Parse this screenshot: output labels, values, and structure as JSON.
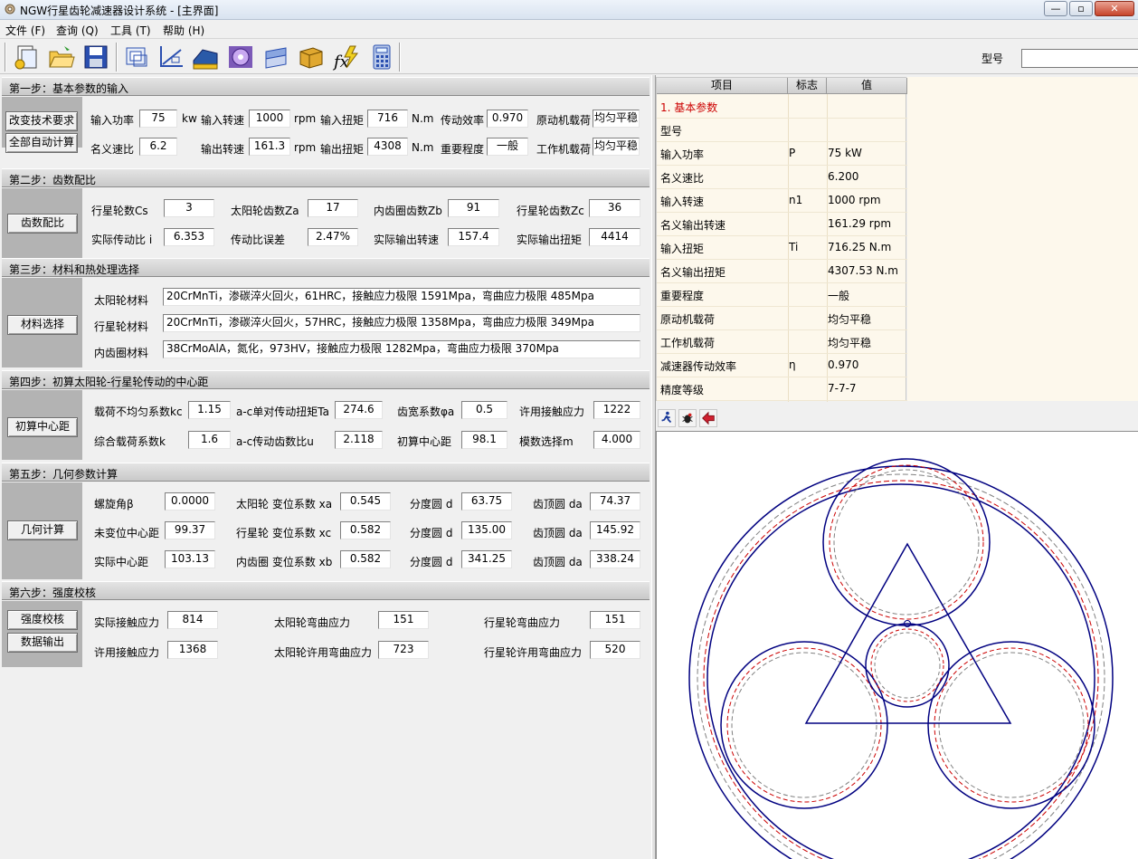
{
  "window": {
    "title": "NGW行星齿轮减速器设计系统 - [主界面]",
    "minimize": "—",
    "restore": "▫",
    "close": "✕"
  },
  "menu": [
    "文件 (F)",
    "查询 (Q)",
    "工具 (T)",
    "帮助 (H)"
  ],
  "toolbar": {
    "icons": [
      "new-doc-icon",
      "open-folder-icon",
      "save-disk-icon",
      "print-preview-icon",
      "axes-chart-icon",
      "ruler-block-icon",
      "gear-disc-icon",
      "layers-icon",
      "box-icon",
      "fx-formula-icon",
      "calculator-icon"
    ],
    "model_label": "型号",
    "model_value": ""
  },
  "step1": {
    "header": "第一步：基本参数的输入",
    "buttons": [
      "改变技术要求",
      "全部自动计算"
    ],
    "input_power_label": "输入功率",
    "input_power": "75",
    "input_power_unit": "kw",
    "input_speed_label": "输入转速",
    "input_speed": "1000",
    "input_speed_unit": "rpm",
    "input_torque_label": "输入扭矩",
    "input_torque": "716",
    "input_torque_unit": "N.m",
    "efficiency_label": "传动效率",
    "efficiency": "0.970",
    "prime_mover_label": "原动机载荷",
    "prime_mover": "均匀平稳",
    "ratio_label": "名义速比",
    "ratio": "6.2",
    "output_speed_label": "输出转速",
    "output_speed": "161.3",
    "output_speed_unit": "rpm",
    "output_torque_label": "输出扭矩",
    "output_torque": "4308",
    "output_torque_unit": "N.m",
    "importance_label": "重要程度",
    "importance": "一般",
    "work_machine_label": "工作机载荷",
    "work_machine": "均匀平稳"
  },
  "step2": {
    "header": "第二步：齿数配比",
    "button": "齿数配比",
    "cs_label": "行星轮数Cs",
    "cs": "3",
    "za_label": "太阳轮齿数Za",
    "za": "17",
    "zb_label": "内齿圈齿数Zb",
    "zb": "91",
    "zc_label": "行星轮齿数Zc",
    "zc": "36",
    "actual_ratio_label": "实际传动比 i",
    "actual_ratio": "6.353",
    "ratio_error_label": "传动比误差",
    "ratio_error": "2.47%",
    "actual_out_speed_label": "实际输出转速",
    "actual_out_speed": "157.4",
    "actual_out_torque_label": "实际输出扭矩",
    "actual_out_torque": "4414"
  },
  "step3": {
    "header": "第三步：材料和热处理选择",
    "button": "材料选择",
    "sun_label": "太阳轮材料",
    "sun": "20CrMnTi，渗碳淬火回火，61HRC，接触应力极限 1591Mpa，弯曲应力极限 485Mpa",
    "planet_label": "行星轮材料",
    "planet": "20CrMnTi，渗碳淬火回火，57HRC，接触应力极限 1358Mpa，弯曲应力极限 349Mpa",
    "ring_label": "内齿圈材料",
    "ring": "38CrMoAlA，氮化，973HV，接触应力极限 1282Mpa，弯曲应力极限 370Mpa"
  },
  "step4": {
    "header": "第四步：初算太阳轮-行星轮传动的中心距",
    "button": "初算中心距",
    "kc_label": "载荷不均匀系数kc",
    "kc": "1.15",
    "ta_label": "a-c单对传动扭矩Ta",
    "ta": "274.6",
    "phia_label": "齿宽系数φa",
    "phia": "0.5",
    "allow_contact_label": "许用接触应力",
    "allow_contact": "1222",
    "k_label": "综合载荷系数k",
    "k": "1.6",
    "u_label": "a-c传动齿数比u",
    "u": "2.118",
    "init_center_label": "初算中心距",
    "init_center": "98.1",
    "module_label": "模数选择m",
    "module": "4.000"
  },
  "step5": {
    "header": "第五步：几何参数计算",
    "button": "几何计算",
    "beta_label": "螺旋角β",
    "beta": "0.0000",
    "xa_label": "太阳轮 变位系数 xa",
    "xa": "0.545",
    "d1_label": "分度圆 d",
    "d1": "63.75",
    "da1_label": "齿顶圆 da",
    "da1": "74.37",
    "unshift_center_label": "未变位中心距",
    "unshift_center": "99.37",
    "xc_label": "行星轮 变位系数 xc",
    "xc": "0.582",
    "d2_label": "分度圆 d",
    "d2": "135.00",
    "da2_label": "齿顶圆 da",
    "da2": "145.92",
    "actual_center_label": "实际中心距",
    "actual_center": "103.13",
    "xb_label": "内齿圈 变位系数 xb",
    "xb": "0.582",
    "d3_label": "分度圆 d",
    "d3": "341.25",
    "da3_label": "齿顶圆 da",
    "da3": "338.24"
  },
  "step6": {
    "header": "第六步：强度校核",
    "buttons": [
      "强度校核",
      "数据输出"
    ],
    "actual_contact_label": "实际接触应力",
    "actual_contact": "814",
    "sun_bend_label": "太阳轮弯曲应力",
    "sun_bend": "151",
    "planet_bend_label": "行星轮弯曲应力",
    "planet_bend": "151",
    "allow_contact_label": "许用接触应力",
    "allow_contact": "1368",
    "sun_allow_bend_label": "太阳轮许用弯曲应力",
    "sun_allow_bend": "723",
    "planet_allow_bend_label": "行星轮许用弯曲应力",
    "planet_allow_bend": "520"
  },
  "info_table": {
    "columns": [
      "项目",
      "标志",
      "值"
    ],
    "rows": [
      {
        "item": "1. 基本参数",
        "symbol": "",
        "value": ""
      },
      {
        "item": "型号",
        "symbol": "",
        "value": ""
      },
      {
        "item": "输入功率",
        "symbol": "P",
        "value": "75 kW"
      },
      {
        "item": "名义速比",
        "symbol": "",
        "value": "6.200"
      },
      {
        "item": "输入转速",
        "symbol": "n1",
        "value": "1000 rpm"
      },
      {
        "item": "名义输出转速",
        "symbol": "",
        "value": "161.29 rpm"
      },
      {
        "item": "输入扭矩",
        "symbol": "Ti",
        "value": "716.25 N.m"
      },
      {
        "item": "名义输出扭矩",
        "symbol": "",
        "value": "4307.53 N.m"
      },
      {
        "item": "重要程度",
        "symbol": "",
        "value": "一般"
      },
      {
        "item": "原动机载荷",
        "symbol": "",
        "value": "均匀平稳"
      },
      {
        "item": "工作机载荷",
        "symbol": "",
        "value": "均匀平稳"
      },
      {
        "item": "减速器传动效率",
        "symbol": "η",
        "value": "0.970"
      },
      {
        "item": "精度等级",
        "symbol": "",
        "value": "7-7-7"
      }
    ]
  },
  "colors": {
    "section_highlight": "#cc0000",
    "gear_line": "#000080",
    "gear_pitch_dash": "#cc0000",
    "gear_ref_dash": "#808080"
  }
}
